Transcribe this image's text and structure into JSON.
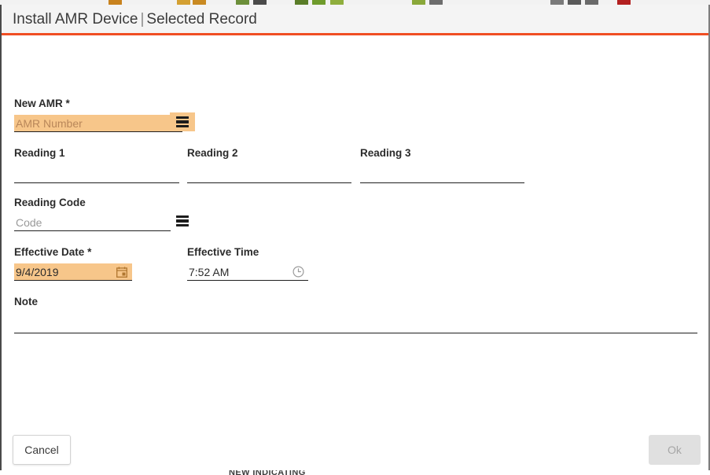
{
  "background": {
    "bottom_label": "NEW INDICATING",
    "toolbar_icon_colors": [
      "#c8821e",
      "#d4a032",
      "#6c8f3a",
      "#4e7c1f",
      "#6f9b2c",
      "#8fae3d",
      "#7a7a7a",
      "#5a5a5a",
      "#b32020"
    ]
  },
  "dialog": {
    "title_primary": "Install AMR Device",
    "title_separator": "|",
    "title_secondary": "Selected Record",
    "accent_color": "#f04e23",
    "highlight_color": "#f7c68a"
  },
  "form": {
    "new_amr": {
      "label": "New AMR",
      "required_marker": "*",
      "value": "",
      "placeholder": "AMR Number",
      "lookup_icon": "hamburger-list-icon"
    },
    "reading_1": {
      "label": "Reading 1",
      "value": "",
      "placeholder": ""
    },
    "reading_2": {
      "label": "Reading 2",
      "value": "",
      "placeholder": ""
    },
    "reading_3": {
      "label": "Reading 3",
      "value": "",
      "placeholder": ""
    },
    "reading_code": {
      "label": "Reading Code",
      "value": "",
      "placeholder": "Code",
      "lookup_icon": "hamburger-list-icon"
    },
    "effective_date": {
      "label": "Effective Date",
      "required_marker": "*",
      "value": "9/4/2019",
      "placeholder": "",
      "picker_icon": "calendar-icon"
    },
    "effective_time": {
      "label": "Effective Time",
      "value": "7:52 AM",
      "placeholder": "",
      "picker_icon": "clock-icon"
    },
    "note": {
      "label": "Note",
      "value": "",
      "placeholder": ""
    }
  },
  "footer": {
    "cancel_label": "Cancel",
    "ok_label": "Ok",
    "ok_disabled": true
  }
}
